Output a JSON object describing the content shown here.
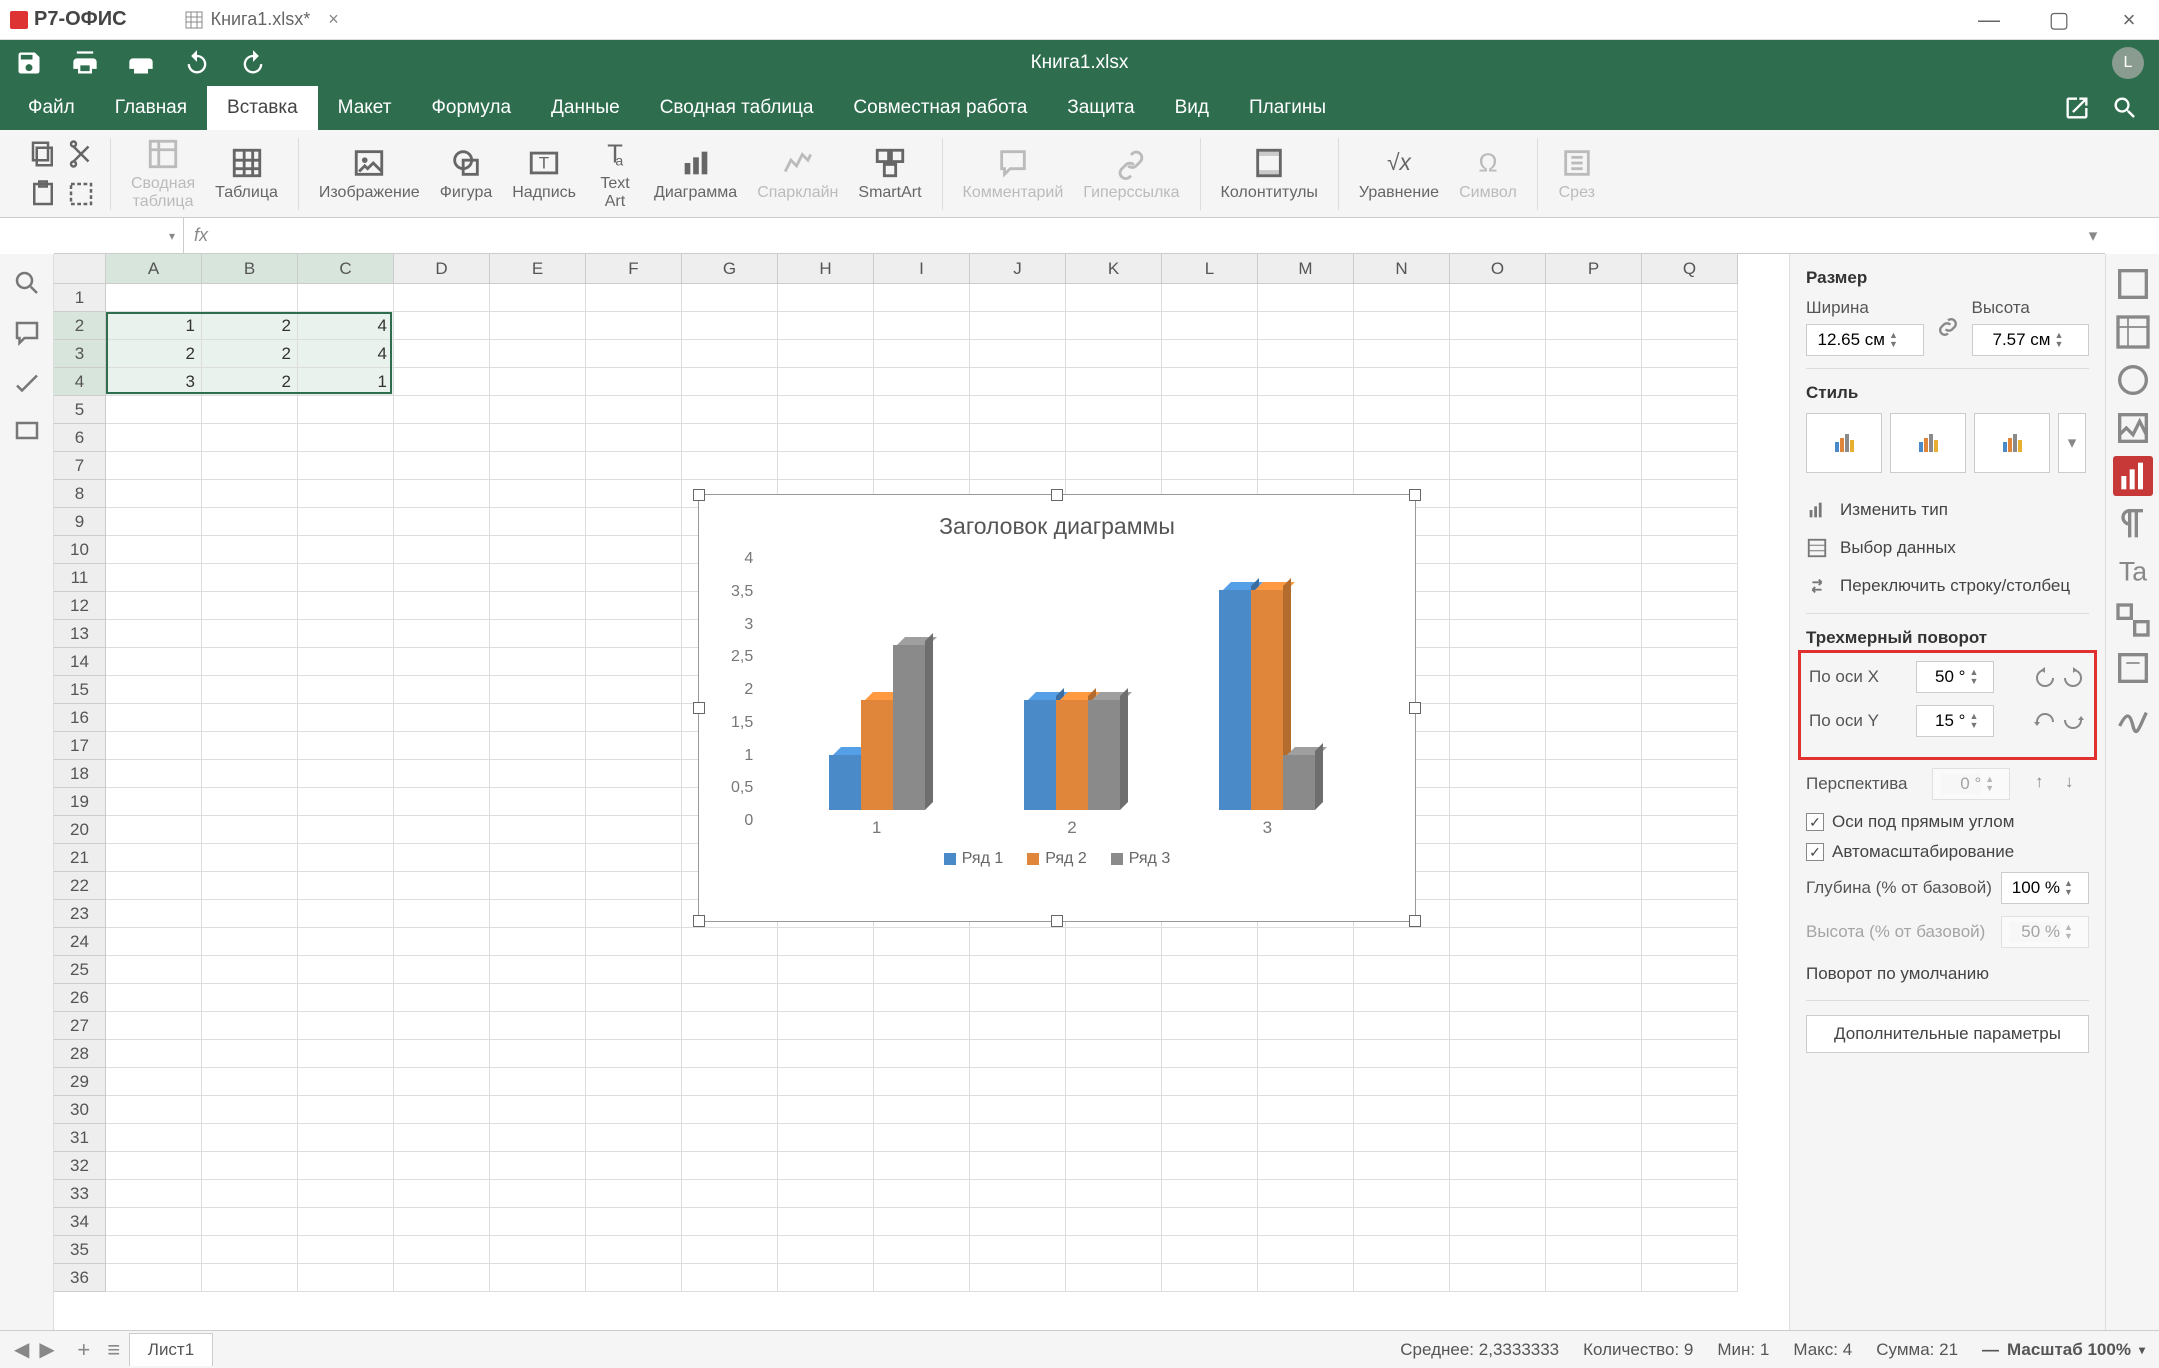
{
  "app": {
    "name": "Р7-ОФИС",
    "doc_tab": "Книга1.xlsx*",
    "doc_title": "Книга1.xlsx",
    "avatar": "L"
  },
  "menu": {
    "items": [
      "Файл",
      "Главная",
      "Вставка",
      "Макет",
      "Формула",
      "Данные",
      "Сводная таблица",
      "Совместная работа",
      "Защита",
      "Вид",
      "Плагины"
    ],
    "active": 2
  },
  "ribbon": {
    "pivot": "Сводная\nтаблица",
    "table": "Таблица",
    "image": "Изображение",
    "shape": "Фигура",
    "textbox": "Надпись",
    "textart": "Text\nArt",
    "chart": "Диаграмма",
    "sparkline": "Спарклайн",
    "smartart": "SmartArt",
    "comment": "Комментарий",
    "hyperlink": "Гиперссылка",
    "headerfooter": "Колонтитулы",
    "equation": "Уравнение",
    "symbol": "Символ",
    "slicer": "Срез"
  },
  "formula": {
    "namebox": "",
    "fx": "fx"
  },
  "grid": {
    "cols": [
      "A",
      "B",
      "C",
      "D",
      "E",
      "F",
      "G",
      "H",
      "I",
      "J",
      "K",
      "L",
      "M",
      "N",
      "O",
      "P",
      "Q"
    ],
    "rows": 36,
    "sel_rows": [
      2,
      3,
      4
    ],
    "sel_cols": [
      0,
      1,
      2
    ],
    "data": {
      "1": {
        "A": "",
        "B": "",
        "C": ""
      },
      "2": {
        "A": "1",
        "B": "2",
        "C": "4"
      },
      "3": {
        "A": "2",
        "B": "2",
        "C": "4"
      },
      "4": {
        "A": "3",
        "B": "2",
        "C": "1"
      }
    }
  },
  "chart_data": {
    "type": "bar",
    "title": "Заголовок диаграммы",
    "categories": [
      "1",
      "2",
      "3"
    ],
    "series": [
      {
        "name": "Ряд 1",
        "values": [
          1,
          2,
          4
        ],
        "color": "#4a8ac9"
      },
      {
        "name": "Ряд 2",
        "values": [
          2,
          2,
          4
        ],
        "color": "#e0863a"
      },
      {
        "name": "Ряд 3",
        "values": [
          3,
          2,
          1
        ],
        "color": "#8a8a8a"
      }
    ],
    "ylim": [
      0,
      4
    ],
    "yticks": [
      "4",
      "3,5",
      "3",
      "2,5",
      "2",
      "1,5",
      "1",
      "0,5",
      "0"
    ]
  },
  "panel": {
    "size_title": "Размер",
    "width_label": "Ширина",
    "width": "12.65 см",
    "height_label": "Высота",
    "height": "7.57 см",
    "style_title": "Стиль",
    "change_type": "Изменить тип",
    "select_data": "Выбор данных",
    "switch": "Переключить строку/столбец",
    "rot_title": "Трехмерный поворот",
    "axis_x": "По оси X",
    "axis_x_val": "50 °",
    "axis_y": "По оси Y",
    "axis_y_val": "15 °",
    "perspective": "Перспектива",
    "perspective_val": "0 °",
    "right_angle": "Оси под прямым углом",
    "autoscale": "Автомасштабирование",
    "depth": "Глубина (% от базовой)",
    "depth_val": "100 %",
    "height_pct": "Высота (% от базовой)",
    "height_pct_val": "50 %",
    "reset": "Поворот по умолчанию",
    "advanced": "Дополнительные параметры"
  },
  "status": {
    "sheet": "Лист1",
    "avg_l": "Среднее:",
    "avg": "2,3333333",
    "count_l": "Количество:",
    "count": "9",
    "min_l": "Мин:",
    "min": "1",
    "max_l": "Макс:",
    "max": "4",
    "sum_l": "Сумма:",
    "sum": "21",
    "zoom": "Масштаб 100%"
  }
}
